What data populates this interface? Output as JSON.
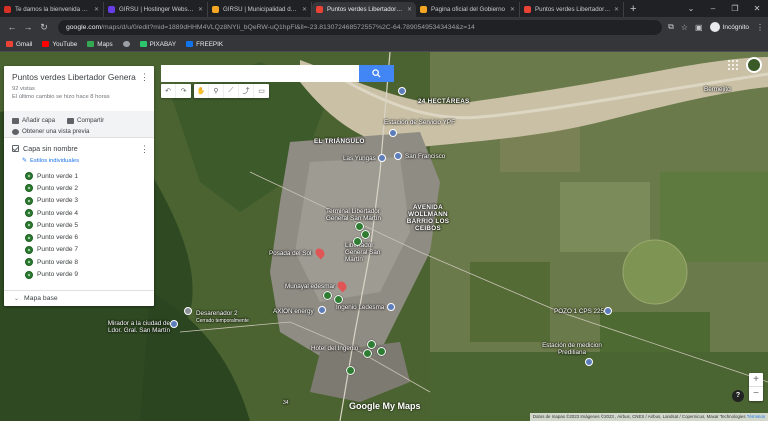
{
  "browser": {
    "tabs": [
      {
        "title": "Te damos la bienvenida al p",
        "color": "#d93025",
        "active": false
      },
      {
        "title": "GIRSU | Hostinger Website B",
        "color": "#673de6",
        "active": false
      },
      {
        "title": "GIRSU | Municipalidad de Lib",
        "color": "#f5a623",
        "active": false
      },
      {
        "title": "Puntos verdes Libertador Ge",
        "color": "#ea4335",
        "active": true
      },
      {
        "title": "Pagina oficial del Gobierno",
        "color": "#f5a623",
        "active": false
      },
      {
        "title": "Puntos verdes Libertador Ge",
        "color": "#ea4335",
        "active": false
      }
    ],
    "url_host": "google.com",
    "url_path": "/maps/d/u/0/edit?mid=1889dHHM4VLQz8NYIi_bQeRW-uQ1hpFl&ll=-23.813072468572557%2C-64.78905495343434&z=14",
    "incognito_label": "Incógnito",
    "bookmarks": [
      {
        "label": "Gmail",
        "color": "#ea4335"
      },
      {
        "label": "YouTube",
        "color": "#ff0000"
      },
      {
        "label": "Maps",
        "color": "#34a853"
      },
      {
        "label": "",
        "color": "#9aa0a6"
      },
      {
        "label": "PIXABAY",
        "color": "#2ec66d"
      },
      {
        "label": "FREEPIK",
        "color": "#1273eb"
      }
    ]
  },
  "panel": {
    "title": "Puntos verdes Libertador General ...",
    "views": "92 vistas",
    "last_edit": "El último cambio se hizo hace 8 horas",
    "add_layer": "Añadir capa",
    "share": "Compartir",
    "preview": "Obtener una vista previa",
    "layer_name": "Capa sin nombre",
    "layer_style": "Estilos individuales",
    "points": [
      "Punto verde 1",
      "Punto verde 2",
      "Punto verde 3",
      "Punto verde 4",
      "Punto verde 5",
      "Punto verde 6",
      "Punto verde 7",
      "Punto verde 8",
      "Punto verde 9"
    ],
    "base_map": "Mapa base"
  },
  "search": {
    "placeholder": ""
  },
  "map_labels": {
    "hectareas": "24 HECTÁREAS",
    "bermejito": "Bermejito",
    "estacion": "Estación de Servicio YPF",
    "triangulo": "EL TRIÁNGULO",
    "yungas": "Las Yungas",
    "sanfrancisco": "San Francisco",
    "terminal": "Terminal Libertador General San Martín",
    "avenida": "AVENIDA WOLLMANN BARRIO LOS CEIBOS",
    "ceibos_short": "AVENIDA",
    "posada": "Posada del Sol",
    "gral_sm": "Libertador General San Martín",
    "munayal": "Munayal edesmar",
    "axion": "AXION energy",
    "ingenio": "Ingenio Ledesma",
    "desarenador": "Desarenador 2",
    "desarenador_sub": "Cerrado temporalmente",
    "mirador": "Mirador a la ciudad de Ldor. Gral. San Martín",
    "pozo": "POZO 1 CPS 225",
    "hotel": "Hotel del Ingenio",
    "estacion_prediliana": "Estación de medicion Prediliana",
    "logo": "Google My Maps",
    "route34": "34"
  },
  "footer": {
    "attribution": "Datos de mapas ©2023 Imágenes ©2023 , Airbus, CNES / Airbus, Landsat / Copernicus, Maxar Technologies",
    "terms": "Términos"
  },
  "colors": {
    "accent": "#4285f4",
    "point_green": "#2e7d32",
    "map_base": "#445a2c"
  }
}
